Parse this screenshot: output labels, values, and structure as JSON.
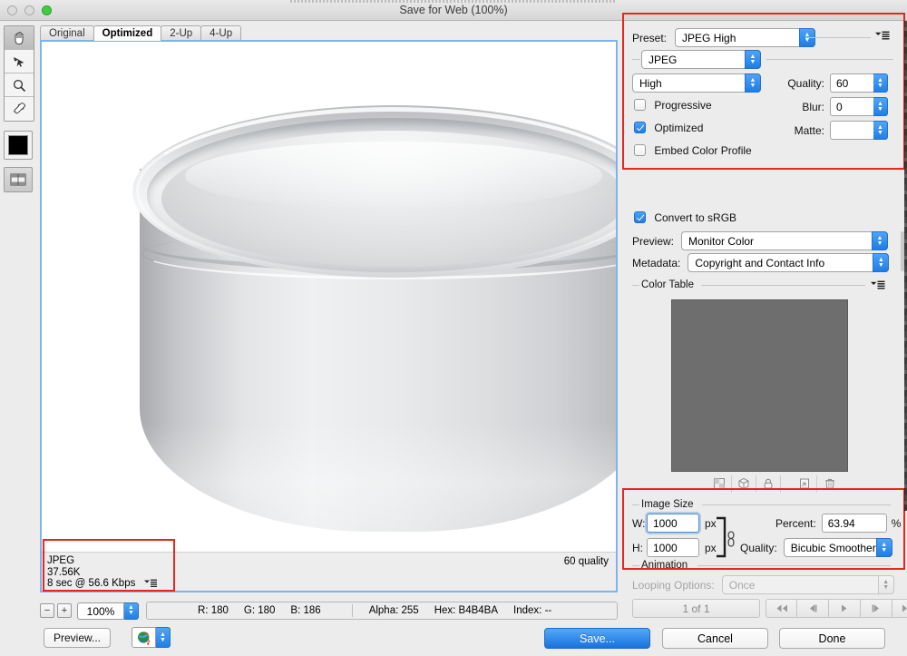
{
  "window": {
    "title": "Save for Web (100%)",
    "traffic_lights": [
      "close",
      "minimize",
      "zoom"
    ]
  },
  "toolbar": {
    "tools": [
      {
        "name": "hand-tool",
        "selected": true
      },
      {
        "name": "slice-select-tool",
        "selected": false
      },
      {
        "name": "zoom-tool",
        "selected": false
      },
      {
        "name": "eyedropper-tool",
        "selected": false
      }
    ],
    "foreground_color": "#000000",
    "toggle_slices_label": "Toggle Slices Visibility"
  },
  "preview": {
    "tabs": [
      {
        "label": "Original",
        "active": false
      },
      {
        "label": "Optimized",
        "active": true
      },
      {
        "label": "2-Up",
        "active": false
      },
      {
        "label": "4-Up",
        "active": false
      }
    ],
    "info": {
      "format": "JPEG",
      "filesize": "37.56K",
      "download_time": "8 sec @ 56.6 Kbps",
      "quality_note": "60 quality"
    }
  },
  "statusbar": {
    "zoom_out_label": "−",
    "zoom_in_label": "+",
    "zoom_level": "100%",
    "color_readout": [
      {
        "label": "R:",
        "value": "180"
      },
      {
        "label": "G:",
        "value": "180"
      },
      {
        "label": "B:",
        "value": "186"
      }
    ],
    "color_readout2": [
      {
        "label": "Alpha:",
        "value": "255"
      },
      {
        "label": "Hex:",
        "value": "B4B4BA"
      },
      {
        "label": "Index:",
        "value": "--"
      }
    ]
  },
  "bottombar": {
    "preview_label": "Preview...",
    "browser_icon": "browser-globe-icon",
    "save_label": "Save...",
    "cancel_label": "Cancel",
    "done_label": "Done"
  },
  "settings": {
    "preset_label": "Preset:",
    "preset_value": "JPEG High",
    "format_value": "JPEG",
    "compression_value": "High",
    "quality_label": "Quality:",
    "quality_value": "60",
    "blur_label": "Blur:",
    "blur_value": "0",
    "matte_label": "Matte:",
    "matte_value": "",
    "progressive_label": "Progressive",
    "progressive_checked": false,
    "optimized_label": "Optimized",
    "optimized_checked": true,
    "embed_color_profile_label": "Embed Color Profile",
    "embed_color_profile_checked": false
  },
  "color": {
    "convert_srgb_label": "Convert to sRGB",
    "convert_srgb_checked": true,
    "preview_label": "Preview:",
    "preview_value": "Monitor Color",
    "metadata_label": "Metadata:",
    "metadata_value": "Copyright and Contact Info"
  },
  "color_table": {
    "title": "Color Table",
    "swatch_color": "#6e6e6e",
    "buttons": [
      {
        "name": "transparency-icon"
      },
      {
        "name": "web-shift-cube-icon"
      },
      {
        "name": "lock-icon"
      },
      {
        "name": "new-color-icon"
      },
      {
        "name": "delete-trash-icon"
      }
    ]
  },
  "image_size": {
    "title": "Image Size",
    "w_label": "W:",
    "w_value": "1000",
    "w_unit": "px",
    "h_label": "H:",
    "h_value": "1000",
    "h_unit": "px",
    "percent_label": "Percent:",
    "percent_value": "63.94",
    "percent_unit": "%",
    "quality_label": "Quality:",
    "quality_value": "Bicubic Smoother",
    "link_icon": "chain-link-icon"
  },
  "animation": {
    "title": "Animation",
    "looping_label": "Looping Options:",
    "looping_value": "Once",
    "frame_counter": "1 of 1",
    "nav_buttons": [
      {
        "name": "first-frame-button",
        "glyph": "◀◀"
      },
      {
        "name": "previous-frame-button",
        "glyph": "◀|"
      },
      {
        "name": "play-button",
        "glyph": "▶"
      },
      {
        "name": "next-frame-button",
        "glyph": "|▶"
      },
      {
        "name": "last-frame-button",
        "glyph": "▶▶"
      }
    ]
  },
  "annotations": {
    "highlight_color": "#e8261c"
  }
}
